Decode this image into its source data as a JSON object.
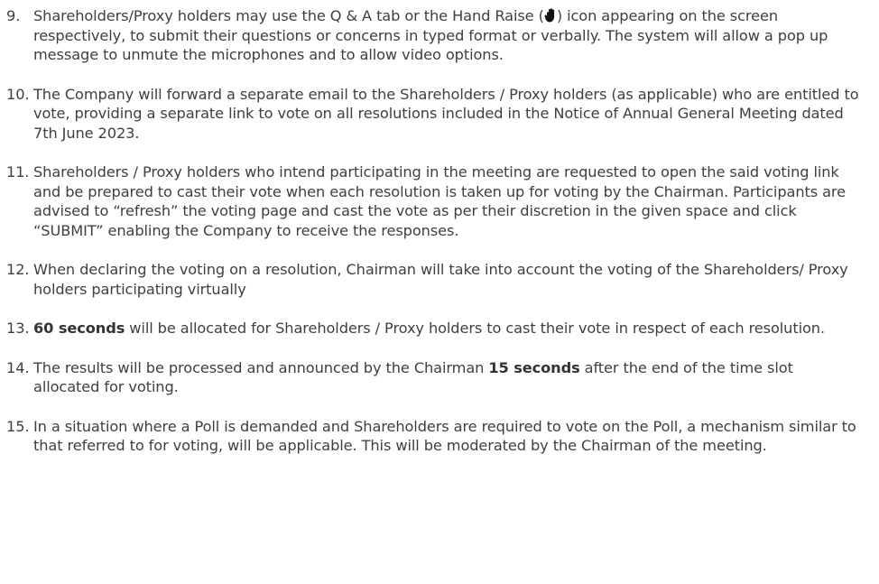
{
  "items": [
    {
      "number": "9.",
      "text_before_icon": "Shareholders/Proxy holders may use the Q & A tab or the Hand Raise (",
      "icon": "hand-raise-icon",
      "text_after_icon": ") icon appearing on the screen respectively, to submit their questions or concerns in typed format or verbally. The system will allow a pop up message to unmute the microphones and to allow video options."
    },
    {
      "number": "10.",
      "text": "The Company will forward a separate email to the Shareholders / Proxy holders (as applicable) who are entitled to vote, providing a separate link to vote on all resolutions included in the Notice of Annual General Meeting dated 7th June 2023."
    },
    {
      "number": "11.",
      "text": "Shareholders / Proxy holders who intend participating in the meeting are requested to open the said voting link and be prepared to cast their vote when each resolution is taken up for voting by the Chairman. Participants are advised to “refresh” the voting page and cast the vote as per their discretion in the given space and click “SUBMIT” enabling the Company to receive the responses."
    },
    {
      "number": "12.",
      "text": "When declaring the voting on a resolution, Chairman will take into account the voting of the Shareholders/ Proxy holders participating virtually"
    },
    {
      "number": "13.",
      "bold_lead": "60 seconds",
      "text": " will be allocated for Shareholders / Proxy holders to cast their vote in respect of each resolution."
    },
    {
      "number": "14.",
      "text_before_bold": "The results will be processed and announced by the Chairman ",
      "bold_mid": "15 seconds",
      "text_after_bold": " after the end of the time slot allocated for voting."
    },
    {
      "number": "15.",
      "text": "In a situation where a Poll is demanded and Shareholders are required to vote on the Poll, a mechanism similar to that referred to for voting, will be applicable. This will be moderated by the Chairman of the meeting."
    }
  ]
}
